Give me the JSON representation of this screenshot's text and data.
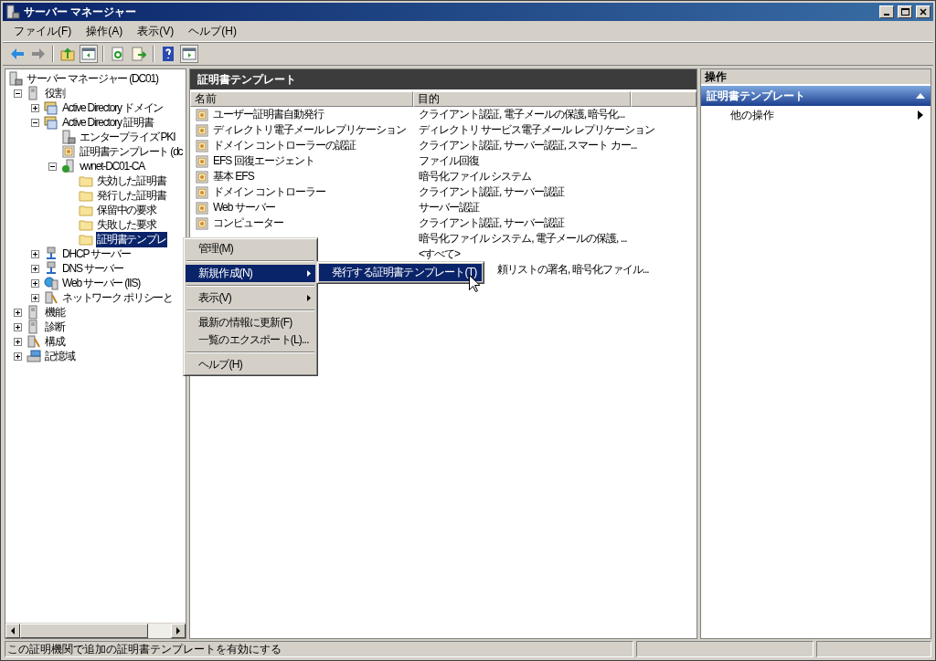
{
  "window": {
    "title": "サーバー マネージャー"
  },
  "menu_bar": [
    "ファイル(F)",
    "操作(A)",
    "表示(V)",
    "ヘルプ(H)"
  ],
  "toolbar": [
    {
      "kind": "back",
      "disabled": false
    },
    {
      "kind": "forward",
      "disabled": true
    },
    {
      "kind": "separator"
    },
    {
      "kind": "up",
      "pressed": false
    },
    {
      "kind": "tree-pane",
      "pressed": true
    },
    {
      "kind": "separator"
    },
    {
      "kind": "refresh",
      "pressed": false
    },
    {
      "kind": "export",
      "pressed": false
    },
    {
      "kind": "separator"
    },
    {
      "kind": "help",
      "pressed": false
    },
    {
      "kind": "action-pane",
      "pressed": true
    }
  ],
  "tree": {
    "label": "サーバー マネージャー (DC01)",
    "kind": "server",
    "selected": false,
    "children": [
      {
        "label": "役割",
        "kind": "role",
        "expanded": true,
        "selected": false,
        "children": [
          {
            "label": "Active Directory ドメイン",
            "kind": "ad",
            "expanded": false,
            "selected": false
          },
          {
            "label": "Active Directory 証明書",
            "kind": "ad",
            "expanded": true,
            "selected": false,
            "children": [
              {
                "label": "エンタープライズ PKI",
                "kind": "server",
                "selected": false
              },
              {
                "label": "証明書テンプレート (dc",
                "kind": "cert",
                "selected": false
              },
              {
                "label": "vwnet-DC01-CA",
                "kind": "ca",
                "expanded": true,
                "selected": false,
                "children": [
                  {
                    "label": "失効した証明書",
                    "kind": "folder",
                    "selected": false
                  },
                  {
                    "label": "発行した証明書",
                    "kind": "folder",
                    "selected": false
                  },
                  {
                    "label": "保留中の要求",
                    "kind": "folder",
                    "selected": false
                  },
                  {
                    "label": "失敗した要求",
                    "kind": "folder",
                    "selected": false
                  },
                  {
                    "label": "証明書テンプレ",
                    "kind": "folder",
                    "selected": true
                  }
                ]
              }
            ]
          },
          {
            "label": "DHCP サーバー",
            "kind": "network",
            "expanded": false,
            "selected": false
          },
          {
            "label": "DNS サーバー",
            "kind": "network",
            "expanded": false,
            "selected": false
          },
          {
            "label": "Web サーバー (IIS)",
            "kind": "web",
            "expanded": false,
            "selected": false
          },
          {
            "label": "ネットワーク ポリシーと",
            "kind": "tool",
            "expanded": false,
            "selected": false
          }
        ]
      },
      {
        "label": "機能",
        "kind": "role",
        "expanded": false,
        "selected": false
      },
      {
        "label": "診断",
        "kind": "role",
        "expanded": false,
        "selected": false
      },
      {
        "label": "構成",
        "kind": "tool",
        "expanded": false,
        "selected": false
      },
      {
        "label": "記憶域",
        "kind": "storage",
        "expanded": false,
        "selected": false
      }
    ]
  },
  "content": {
    "title": "証明書テンプレート",
    "columns": [
      "名前",
      "目的"
    ],
    "rows": [
      {
        "name": "ユーザー証明書自動発行",
        "purpose": "クライアント認証, 電子メールの保護, 暗号化..."
      },
      {
        "name": "ディレクトリ電子メール レプリケーション",
        "purpose": "ディレクトリ サービス電子メール レプリケーション"
      },
      {
        "name": "ドメイン コントローラーの認証",
        "purpose": "クライアント認証, サーバー認証, スマート カー..."
      },
      {
        "name": "EFS 回復エージェント",
        "purpose": "ファイル回復"
      },
      {
        "name": "基本 EFS",
        "purpose": "暗号化ファイル システム"
      },
      {
        "name": "ドメイン コントローラー",
        "purpose": "クライアント認証, サーバー認証"
      },
      {
        "name": "Web サーバー",
        "purpose": "サーバー認証"
      },
      {
        "name": "コンピューター",
        "purpose": "クライアント認証, サーバー認証"
      },
      {
        "purpose": "暗号化ファイル システム, 電子メールの保護, ..."
      },
      {
        "purpose": "<すべて>"
      },
      {
        "purpose": "頼リストの署名, 暗号化ファイル...",
        "kind": "covered"
      }
    ]
  },
  "actions": {
    "title": "操作",
    "section": {
      "label": "証明書テンプレート",
      "expanded": true
    },
    "items": [
      "他の操作"
    ]
  },
  "context_menu": [
    {
      "kind": "item",
      "label": "管理(M)",
      "selected": false,
      "submenu": false
    },
    {
      "kind": "separator"
    },
    {
      "kind": "item",
      "label": "新規作成(N)",
      "selected": true,
      "submenu": true
    },
    {
      "kind": "separator"
    },
    {
      "kind": "item",
      "label": "表示(V)",
      "selected": false,
      "submenu": true
    },
    {
      "kind": "separator"
    },
    {
      "kind": "item",
      "label": "最新の情報に更新(F)",
      "selected": false,
      "submenu": false
    },
    {
      "kind": "item",
      "label": "一覧のエクスポート(L)...",
      "selected": false,
      "submenu": false
    },
    {
      "kind": "separator"
    },
    {
      "kind": "item",
      "label": "ヘルプ(H)",
      "selected": false,
      "submenu": false
    }
  ],
  "submenu": [
    {
      "label": "発行する証明書テンプレート(T)",
      "selected": true
    }
  ],
  "status_bar": {
    "text": "この証明機関で追加の証明書テンプレートを有効にする"
  }
}
